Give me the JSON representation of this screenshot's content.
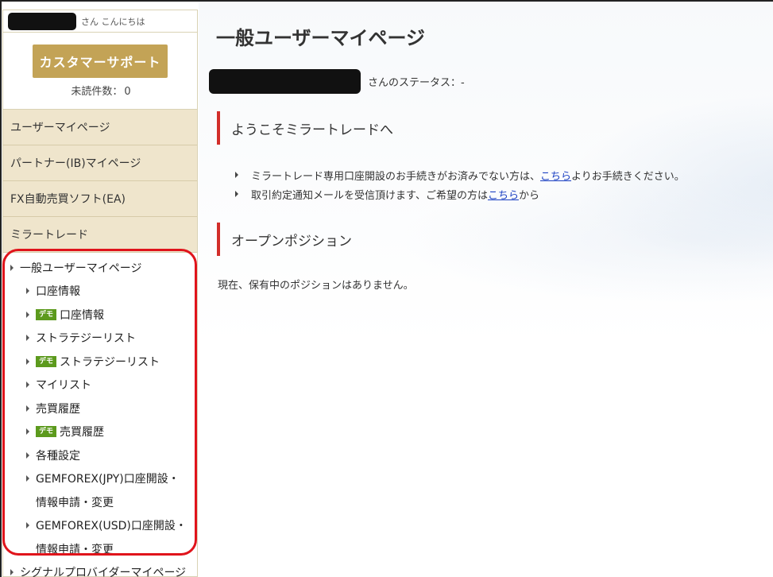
{
  "sidebar": {
    "greeting": "さん こんにちは",
    "support_button": "カスタマーサポート",
    "unread_label": "未読件数：",
    "unread_count": "0",
    "nav_items": [
      "ユーザーマイページ",
      "パートナー(IB)マイページ",
      "FX自動売買ソフト(EA)",
      "ミラートレード"
    ],
    "section_label": "一般ユーザーマイページ",
    "demo_badge": "デモ",
    "sub_items": {
      "account_info": "口座情報",
      "demo_account_info": "口座情報",
      "strategy_list": "ストラテジーリスト",
      "demo_strategy_list": "ストラテジーリスト",
      "my_list": "マイリスト",
      "trade_history": "売買履歴",
      "demo_trade_history": "売買履歴",
      "settings": "各種設定",
      "jpy_open_1": "GEMFOREX(JPY)口座開設・",
      "jpy_open_2": "情報申請・変更",
      "usd_open_1": "GEMFOREX(USD)口座開設・",
      "usd_open_2": "情報申請・変更"
    },
    "signal_provider": "シグナルプロバイダーマイページ"
  },
  "main": {
    "title": "一般ユーザーマイページ",
    "status_text": "さんのステータス：-",
    "welcome_heading": "ようこそミラートレードへ",
    "bullet1_text": "ミラートレード専用口座開設のお手続きがお済みでない方は、",
    "bullet1_link": "こちら",
    "bullet1_suffix": "よりお手続きください。",
    "bullet2_text": "取引約定通知メールを受信頂けます、ご希望の方は",
    "bullet2_link": "こちら",
    "bullet2_suffix": "から",
    "positions_heading": "オープンポジション",
    "no_positions": "現在、保有中のポジションはありません。"
  },
  "colors": {
    "accent_gold": "#c3a356",
    "nav_bg": "#efe5cc",
    "demo_green": "#5c9a1d",
    "section_red": "#d22e2a",
    "highlight_red": "#e0141b",
    "link_blue": "#1a3fc2"
  }
}
